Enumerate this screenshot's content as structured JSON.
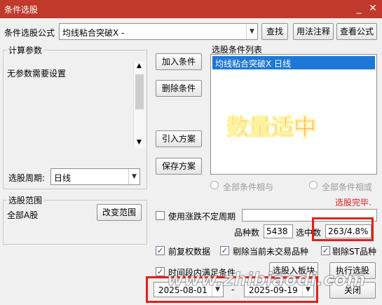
{
  "window": {
    "title": "条件选股"
  },
  "formula": {
    "label": "条件选股公式",
    "value": "均线粘合突破X  -",
    "find_button": "查找",
    "usage_button": "用法注释",
    "view_button": "查看公式"
  },
  "params": {
    "legend": "计算参数",
    "text": "无参数需要设置",
    "period_label": "选股周期:",
    "period_value": "日线"
  },
  "actions": {
    "add": "加入条件",
    "delete": "删除条件",
    "import": "引入方案",
    "save": "保存方案"
  },
  "conditions": {
    "legend": "选股条件列表",
    "items": [
      "均线粘合突破X  日线"
    ]
  },
  "overlay_text": "数量适中",
  "logic": {
    "and_label": "全部条件相与",
    "or_label": "全部条件相或"
  },
  "status": "选股完毕.",
  "range": {
    "legend": "选股范围",
    "value": "全部A股",
    "change_button": "改变范围"
  },
  "options": {
    "uncertain_period": "使用涨跌不定周期",
    "pre_adjust": "前复权数据",
    "exclude_no_trade": "剔除当前未交易品种",
    "exclude_st": "剔除ST品种",
    "period_satisfy": "时间段内满足条件"
  },
  "stats": {
    "count_label": "品种数",
    "count_value": "5438",
    "selected_label": "选中数",
    "selected_value": "263/4.8%"
  },
  "buttons": {
    "to_block": "选股入板块",
    "execute": "执行选股",
    "close": "关闭"
  },
  "dates": {
    "start": "2025-08-01",
    "dash": "-",
    "end": "2025-09-19"
  },
  "watermark": "www.zhibiaodi.com",
  "colors": {
    "titlebar": "#c0392b",
    "selection": "#1e78d7",
    "overlay_text": "#ff2a2a",
    "highlight_box": "#e0201a"
  }
}
